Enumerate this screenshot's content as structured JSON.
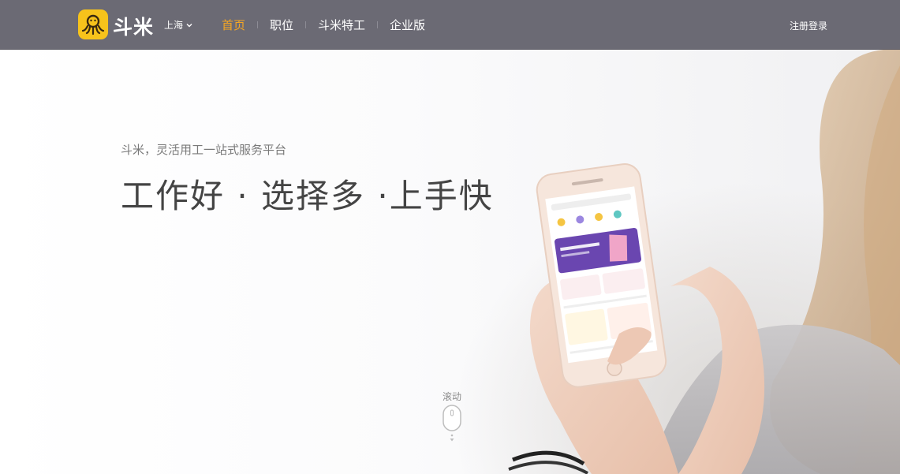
{
  "header": {
    "brand": "斗米",
    "city": "上海",
    "nav": [
      {
        "label": "首页",
        "active": true
      },
      {
        "label": "职位",
        "active": false
      },
      {
        "label": "斗米特工",
        "active": false
      },
      {
        "label": "企业版",
        "active": false
      }
    ],
    "login": "注册登录"
  },
  "hero": {
    "subtitle": "斗米，灵活用工一站式服务平台",
    "headline": "工作好 · 选择多 ·上手快",
    "scroll_label": "滚动"
  },
  "colors": {
    "header_bg": "#6b6a74",
    "accent": "#f5a623",
    "logo_yellow": "#f7c31b",
    "phone_banner": "#6a46b0"
  },
  "icons": [
    "octopus-logo-icon",
    "chevron-down-icon",
    "mouse-scroll-icon"
  ]
}
